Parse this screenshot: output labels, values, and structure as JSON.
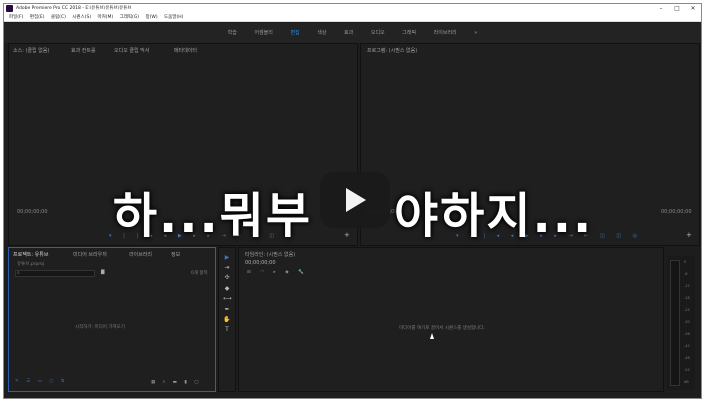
{
  "window": {
    "title": "Adobe Premiere Pro CC 2018 - E:\\유튜브\\유튜브\\유튜브",
    "controls": [
      "–",
      "□",
      "✕"
    ]
  },
  "menu": [
    "파일(F)",
    "편집(E)",
    "클립(C)",
    "시퀀스(S)",
    "마커(M)",
    "그래픽(G)",
    "창(W)",
    "도움말(H)"
  ],
  "workspaces": {
    "items": [
      "학습",
      "어셈블리",
      "편집",
      "색상",
      "효과",
      "오디오",
      "그래픽",
      "라이브러리"
    ],
    "active_index": 2,
    "more": "»"
  },
  "source_panel": {
    "tabs": [
      "소스: (클립 없음)",
      "효과 컨트롤",
      "오디오 클립 믹서",
      "메타데이터"
    ],
    "timecode": "00;00;00;00"
  },
  "program_panel": {
    "tab": "프로그램: (시퀀스 없음)",
    "timecode_left": "00;00;00;00",
    "timecode_right": "00;00;00;00"
  },
  "project_panel": {
    "tabs": [
      "프로젝트: 유튜브",
      "미디어 브라우저",
      "라이브러리",
      "정보"
    ],
    "file": "유튜브.prproj",
    "items_count": "0개 항목",
    "empty_message": "시작하기: 미디어 가져오기"
  },
  "timeline_panel": {
    "tab": "타임라인: (시퀀스 없음)",
    "timecode": "00;00;00;00",
    "empty_message": "미디어를 여기로 끌어서 시퀀스를 생성합니다."
  },
  "overlay": {
    "text_left": "하...뭐부",
    "text_right": "야하지..."
  },
  "meter": {
    "scale": [
      "0",
      "-6",
      "-12",
      "-18",
      "-24",
      "-30",
      "-36",
      "-42",
      "-48",
      "-54",
      "dB"
    ]
  },
  "colors": {
    "accent": "#2d8ceb",
    "panel_bg": "#1f1f1f"
  }
}
